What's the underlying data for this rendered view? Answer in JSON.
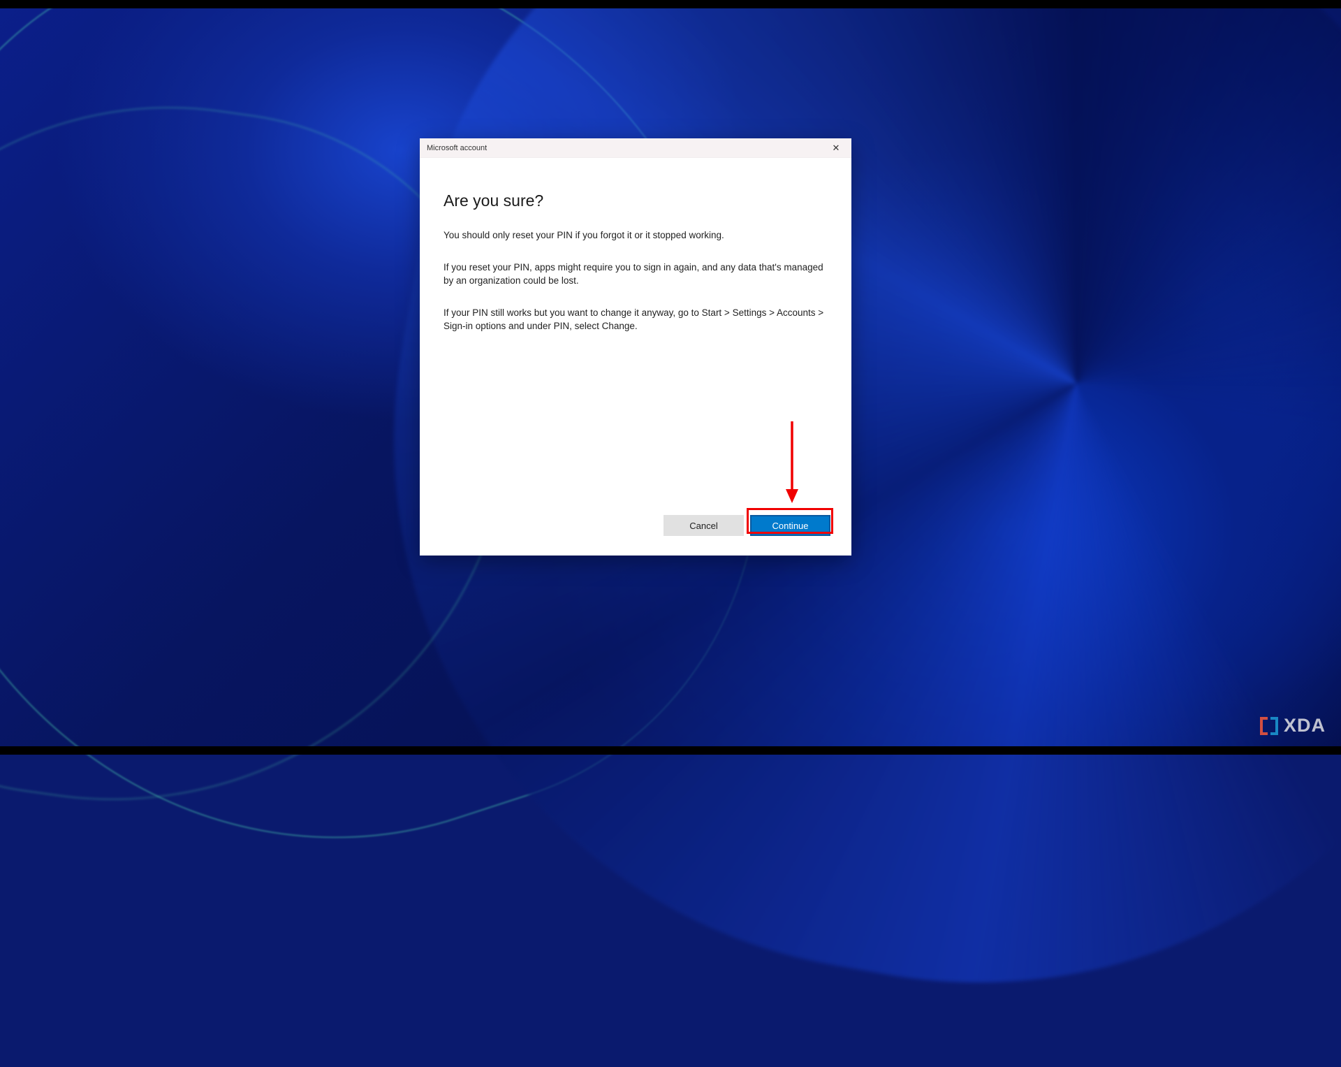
{
  "dialog": {
    "title": "Microsoft account",
    "heading": "Are you sure?",
    "paragraphs": {
      "p1": "You should only reset your PIN if you forgot it or it stopped working.",
      "p2": "If you reset your PIN, apps might require you to sign in again, and any data that's managed by an organization could be lost.",
      "p3": "If your PIN still works but you want to change it anyway, go to Start > Settings > Accounts > Sign-in options and under PIN, select Change."
    },
    "cancel_label": "Cancel",
    "continue_label": "Continue"
  },
  "watermark": {
    "text": "XDA"
  },
  "annotation": {
    "highlight_color": "#f00000"
  }
}
